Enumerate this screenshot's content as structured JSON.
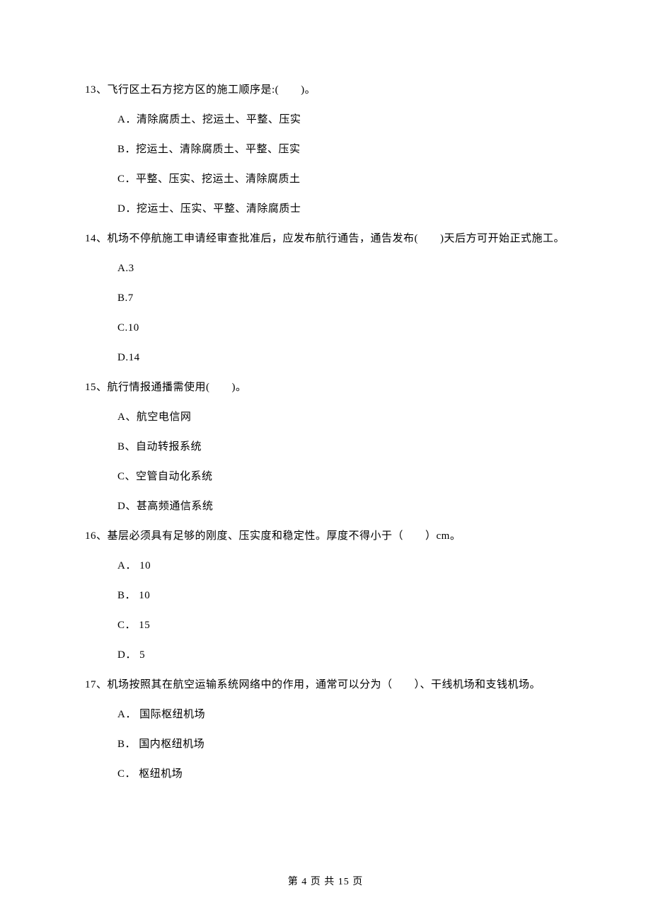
{
  "questions": [
    {
      "stem": "13、飞行区土石方挖方区的施工顺序是:(　　)。",
      "options": [
        "A．清除腐质土、挖运土、平整、压实",
        "B．挖运土、清除腐质土、平整、压实",
        "C．平整、压实、挖运土、清除腐质土",
        "D．挖运士、压实、平整、清除腐质士"
      ]
    },
    {
      "stem": "14、机场不停航施工申请经审查批准后，应发布航行通告，通告发布(　　)天后方可开始正式施工。",
      "options": [
        "A.3",
        "B.7",
        "C.10",
        "D.14"
      ]
    },
    {
      "stem": "15、航行情报通播需使用(　　)。",
      "options": [
        "A、航空电信网",
        "B、自动转报系统",
        "C、空管自动化系统",
        "D、甚高频通信系统"
      ]
    },
    {
      "stem": "16、基层必须具有足够的刚度、压实度和稳定性。厚度不得小于（　　）cm。",
      "options": [
        "A． 10",
        "B． 10",
        "C． 15",
        "D． 5"
      ]
    },
    {
      "stem": "17、机场按照其在航空运输系统网络中的作用，通常可以分为（　　）、干线机场和支钱机场。",
      "options": [
        "A． 国际枢纽机场",
        "B． 国内枢纽机场",
        "C． 枢纽机场"
      ]
    }
  ],
  "footer": "第 4 页 共 15 页"
}
